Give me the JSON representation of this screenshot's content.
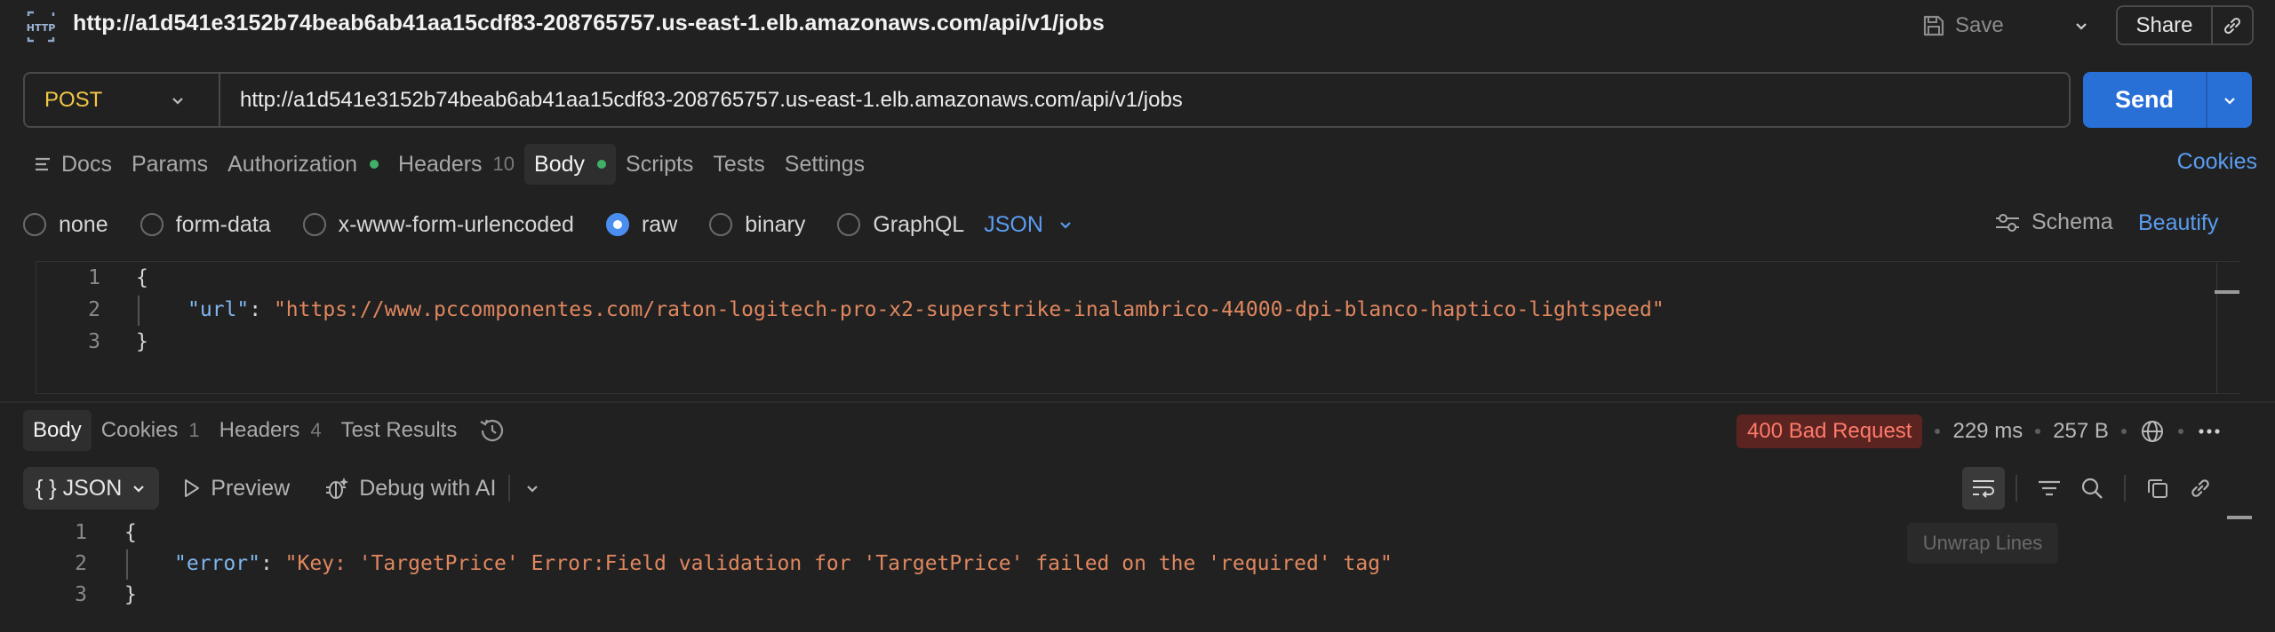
{
  "header": {
    "logo_text": "HTTP",
    "title": "http://a1d541e3152b74beab6ab41aa15cdf83-208765757.us-east-1.elb.amazonaws.com/api/v1/jobs",
    "save_label": "Save",
    "share_label": "Share"
  },
  "request": {
    "method": "POST",
    "url": "http://a1d541e3152b74beab6ab41aa15cdf83-208765757.us-east-1.elb.amazonaws.com/api/v1/jobs",
    "send_label": "Send",
    "tabs": [
      {
        "label": "Docs"
      },
      {
        "label": "Params"
      },
      {
        "label": "Authorization"
      },
      {
        "label": "Headers",
        "count": "10"
      },
      {
        "label": "Body"
      },
      {
        "label": "Scripts"
      },
      {
        "label": "Tests"
      },
      {
        "label": "Settings"
      }
    ],
    "cookies_label": "Cookies",
    "body_types": [
      "none",
      "form-data",
      "x-www-form-urlencoded",
      "raw",
      "binary",
      "GraphQL"
    ],
    "selected_body_type": "raw",
    "format": "JSON",
    "schema_label": "Schema",
    "beautify_label": "Beautify",
    "editor_lines": [
      {
        "num": "1",
        "open": "{"
      },
      {
        "num": "2",
        "key": "\"url\"",
        "colon": ": ",
        "value": "\"https://www.pccomponentes.com/raton-logitech-pro-x2-superstrike-inalambrico-44000-dpi-blanco-haptico-lightspeed\""
      },
      {
        "num": "3",
        "close": "}"
      }
    ]
  },
  "response": {
    "tabs": [
      {
        "label": "Body"
      },
      {
        "label": "Cookies",
        "count": "1"
      },
      {
        "label": "Headers",
        "count": "4"
      },
      {
        "label": "Test Results"
      }
    ],
    "status": "400 Bad Request",
    "time": "229 ms",
    "size": "257 B",
    "format": "{ } JSON",
    "preview_label": "Preview",
    "debug_label": "Debug with AI",
    "tooltip": "Unwrap Lines",
    "editor_lines": [
      {
        "num": "1",
        "open": "{"
      },
      {
        "num": "2",
        "key": "\"error\"",
        "colon": ": ",
        "value": "\"Key: 'TargetPrice' Error:Field validation for 'TargetPrice' failed on the 'required' tag\""
      },
      {
        "num": "3",
        "close": "}"
      }
    ]
  },
  "colors": {
    "accent": "#2970d6",
    "method_post": "#f2c744",
    "status_error": "#ff7a6b",
    "enabled_dot": "#3fb068"
  }
}
